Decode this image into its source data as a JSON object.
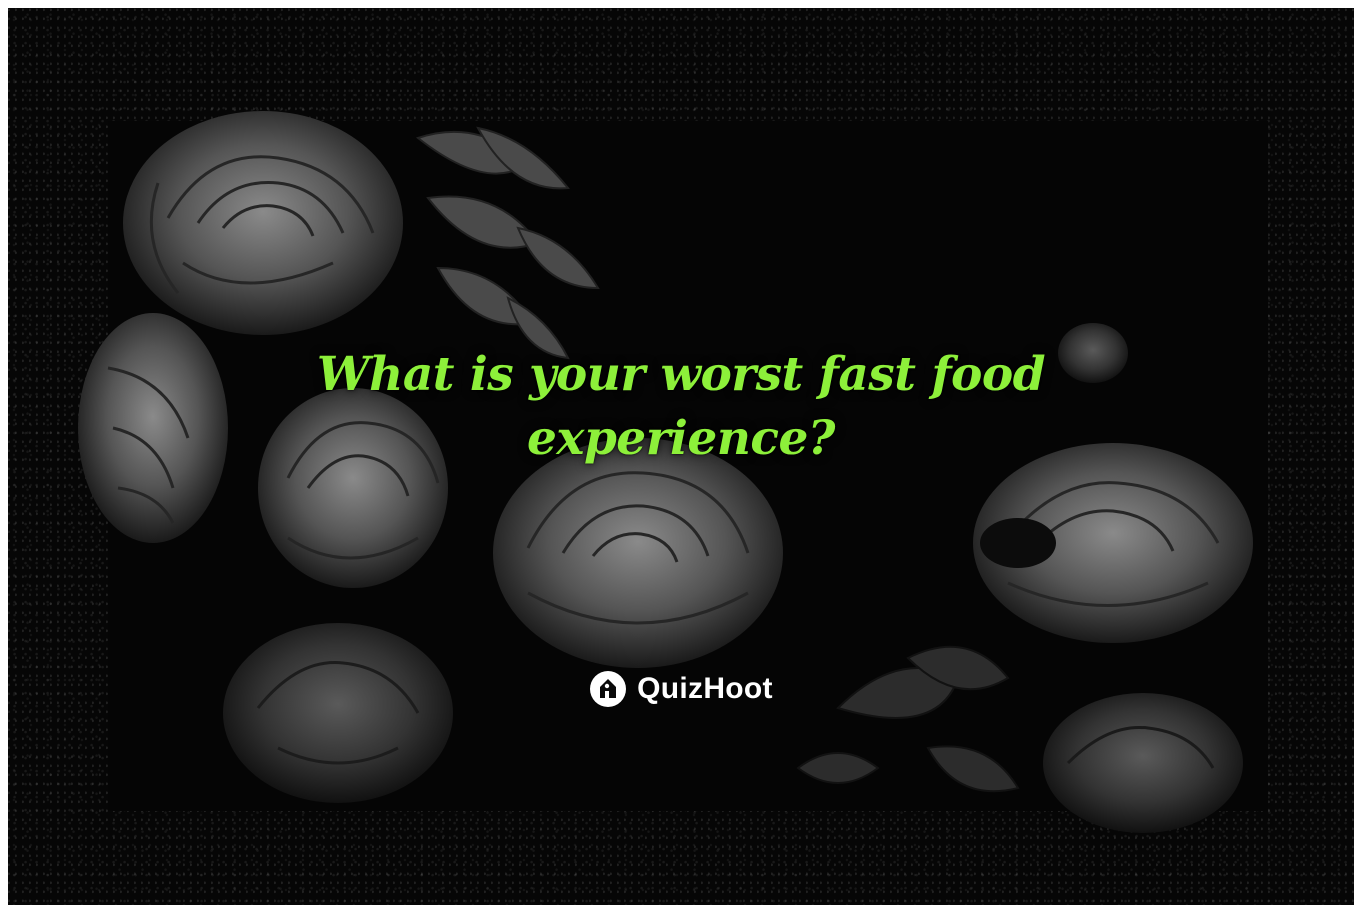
{
  "poster": {
    "question_line1": "What is your worst fast food",
    "question_line2": "experience?",
    "brand": "QuizHoot",
    "brand_icon": "quizhoot-logo-icon",
    "colors": {
      "question_text": "#8df03a",
      "background": "#060606",
      "brand_text": "#ffffff"
    }
  }
}
